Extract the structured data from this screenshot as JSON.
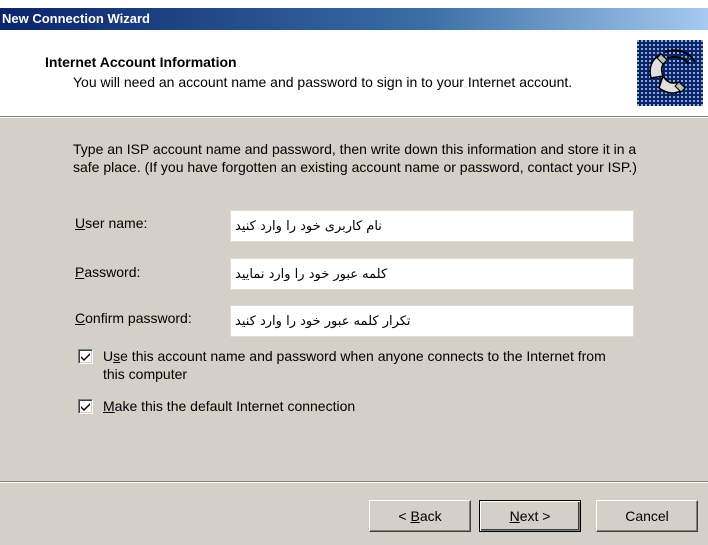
{
  "window": {
    "title": "New Connection Wizard"
  },
  "header": {
    "title": "Internet Account Information",
    "subtitle": "You will need an account name and password to sign in to your Internet account.",
    "icon": "wizard-phone-icon"
  },
  "description": {
    "line1": "Type an ISP account name and password, then write down this information and store it in a",
    "line2": "safe place. (If you have forgotten an existing account name or password, contact your ISP.)"
  },
  "form": {
    "username": {
      "label_mn": "U",
      "label_rest": "ser name:",
      "value": "نام کاربری خود را وارد کنید"
    },
    "password": {
      "label_mn": "P",
      "label_rest": "assword:",
      "value": "کلمه عبور خود را وارد نمایید"
    },
    "confirm": {
      "label_mn": "C",
      "label_rest": "onfirm password:",
      "value": "تکرار کلمه عبور خود را وارد کنید"
    }
  },
  "checkboxes": {
    "use_account": {
      "checked": true,
      "pre": "U",
      "mn": "s",
      "post": "e this account  name and password when anyone connects to the Internet from",
      "line2": "this computer"
    },
    "default_conn": {
      "checked": true,
      "mn": "M",
      "post": "ake this the default Internet connection"
    }
  },
  "buttons": {
    "back": {
      "pre": "< ",
      "mn": "B",
      "post": "ack"
    },
    "next": {
      "mn": "N",
      "post": "ext >"
    },
    "cancel": "Cancel"
  },
  "colors": {
    "title_bar": "#0a246a",
    "dialog_bg": "#d4d0c8"
  }
}
